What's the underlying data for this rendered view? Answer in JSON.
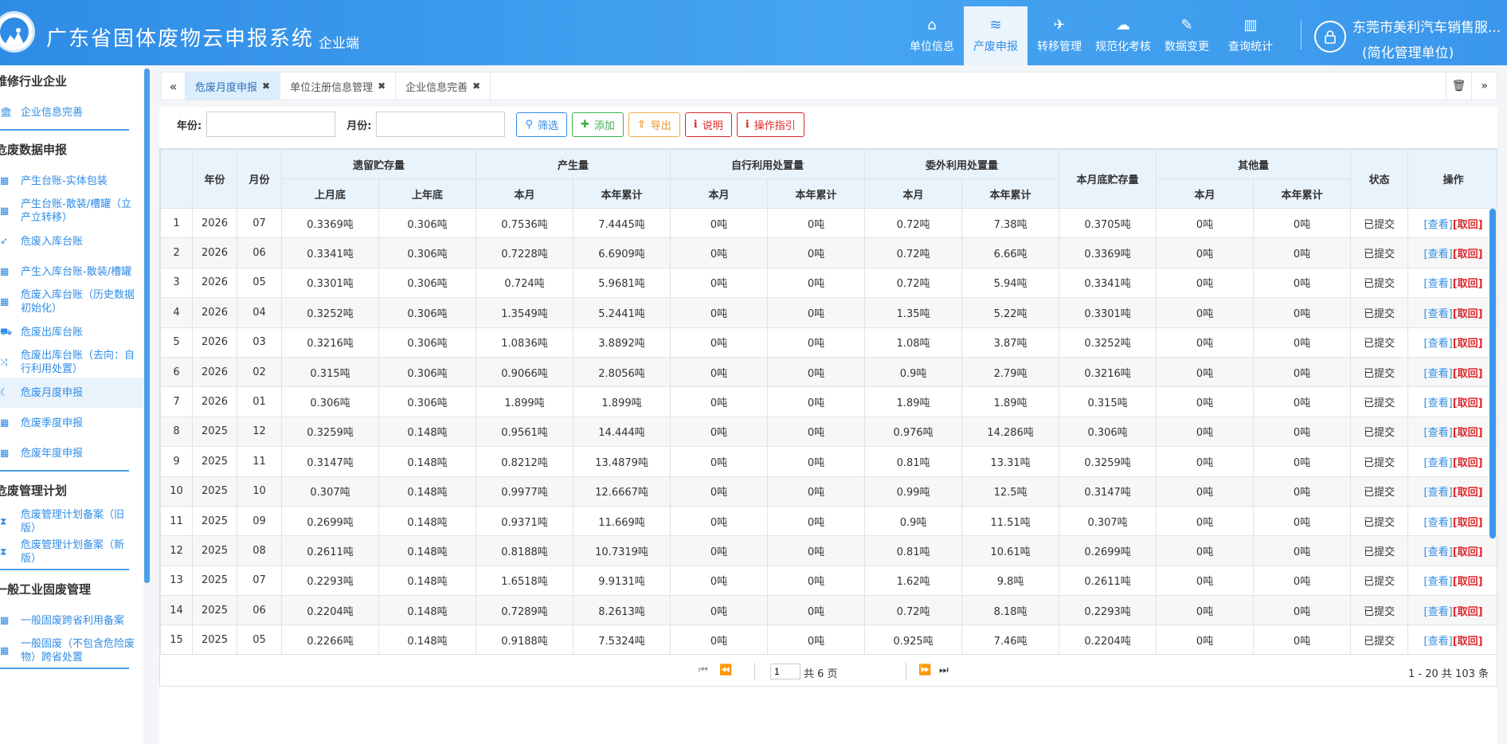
{
  "header": {
    "title": "广东省固体废物云申报系统",
    "subtitle": "企业端",
    "nav": [
      {
        "label": "单位信息",
        "icon": "home-icon",
        "glyph": "⌂",
        "active": false
      },
      {
        "label": "产废申报",
        "icon": "database-icon",
        "glyph": "≋",
        "active": true
      },
      {
        "label": "转移管理",
        "icon": "plane-icon",
        "glyph": "✈",
        "active": false
      },
      {
        "label": "规范化考核",
        "icon": "cloud-upload-icon",
        "glyph": "☁",
        "active": false
      },
      {
        "label": "数据变更",
        "icon": "edit-icon",
        "glyph": "✎",
        "active": false
      },
      {
        "label": "查询统计",
        "icon": "bar-chart-icon",
        "glyph": "▥",
        "active": false
      }
    ],
    "user_name": "东莞市美利汽车销售服...",
    "user_role": "(简化管理单位)"
  },
  "sidebar": {
    "sections": [
      {
        "title": "维修行业企业",
        "items": [
          {
            "label": "企业信息完善",
            "icon": "bank-icon",
            "glyph": "🏛"
          }
        ]
      },
      {
        "title": "危废数据申报",
        "items": [
          {
            "label": "产生台账-实体包装",
            "icon": "calendar-icon",
            "glyph": "▦"
          },
          {
            "label": "产生台账-散装/槽罐（立产立转移）",
            "icon": "calendar-icon",
            "glyph": "▦"
          },
          {
            "label": "危废入库台账",
            "icon": "rocket-icon",
            "glyph": "➶"
          },
          {
            "label": "产生入库台账-散装/槽罐",
            "icon": "calendar-icon",
            "glyph": "▦"
          },
          {
            "label": "危废入库台账（历史数据初始化）",
            "icon": "calendar-icon",
            "glyph": "▦"
          },
          {
            "label": "危废出库台账",
            "icon": "truck-icon",
            "glyph": "⛟"
          },
          {
            "label": "危废出库台账（去向：自行利用处置）",
            "icon": "shuffle-icon",
            "glyph": "⤨"
          },
          {
            "label": "危废月度申报",
            "icon": "moon-icon",
            "glyph": "☾",
            "active": true
          },
          {
            "label": "危废季度申报",
            "icon": "calendar-check-icon",
            "glyph": "▦"
          },
          {
            "label": "危废年度申报",
            "icon": "calendar-icon",
            "glyph": "▦"
          }
        ]
      },
      {
        "title": "危废管理计划",
        "items": [
          {
            "label": "危废管理计划备案（旧版）",
            "icon": "hourglass-icon",
            "glyph": "⧗"
          },
          {
            "label": "危废管理计划备案（新版）",
            "icon": "hourglass-icon",
            "glyph": "⧗"
          }
        ]
      },
      {
        "title": "一般工业固废管理",
        "items": [
          {
            "label": "一般固废跨省利用备案",
            "icon": "calendar-check-icon",
            "glyph": "▦"
          },
          {
            "label": "一般固废（不包含危险废物）跨省处置",
            "icon": "calendar-check-icon",
            "glyph": "▦"
          }
        ]
      }
    ]
  },
  "tabs": {
    "left_arrow": "«",
    "right_arrow": "»",
    "trash": "🗑",
    "items": [
      {
        "label": "危废月度申报",
        "active": true
      },
      {
        "label": "单位注册信息管理",
        "active": false
      },
      {
        "label": "企业信息完善",
        "active": false
      }
    ]
  },
  "filters": {
    "year_label": "年份:",
    "month_label": "月份:",
    "year_value": "",
    "month_value": "",
    "buttons": {
      "filter": "筛选",
      "add": "添加",
      "export": "导出",
      "explain": "说明",
      "guide": "操作指引"
    }
  },
  "table": {
    "headers_top": {
      "year": "年份",
      "month": "月份",
      "carryover": "遗留贮存量",
      "produced": "产生量",
      "self_use": "自行利用处置量",
      "outsourced": "委外利用处置量",
      "month_end_stock": "本月底贮存量",
      "other": "其他量",
      "status": "状态",
      "ops": "操作"
    },
    "headers_sub": {
      "last_month_end": "上月底",
      "last_year_end": "上年底",
      "this_month": "本月",
      "year_total": "本年累计"
    },
    "view_label": "[查看]",
    "revoke_label": "[取回]",
    "rows": [
      [
        "1",
        "2026",
        "07",
        "0.3369吨",
        "0.306吨",
        "0.7536吨",
        "7.4445吨",
        "0吨",
        "0吨",
        "0.72吨",
        "7.38吨",
        "0.3705吨",
        "0吨",
        "0吨",
        "已提交"
      ],
      [
        "2",
        "2026",
        "06",
        "0.3341吨",
        "0.306吨",
        "0.7228吨",
        "6.6909吨",
        "0吨",
        "0吨",
        "0.72吨",
        "6.66吨",
        "0.3369吨",
        "0吨",
        "0吨",
        "已提交"
      ],
      [
        "3",
        "2026",
        "05",
        "0.3301吨",
        "0.306吨",
        "0.724吨",
        "5.9681吨",
        "0吨",
        "0吨",
        "0.72吨",
        "5.94吨",
        "0.3341吨",
        "0吨",
        "0吨",
        "已提交"
      ],
      [
        "4",
        "2026",
        "04",
        "0.3252吨",
        "0.306吨",
        "1.3549吨",
        "5.2441吨",
        "0吨",
        "0吨",
        "1.35吨",
        "5.22吨",
        "0.3301吨",
        "0吨",
        "0吨",
        "已提交"
      ],
      [
        "5",
        "2026",
        "03",
        "0.3216吨",
        "0.306吨",
        "1.0836吨",
        "3.8892吨",
        "0吨",
        "0吨",
        "1.08吨",
        "3.87吨",
        "0.3252吨",
        "0吨",
        "0吨",
        "已提交"
      ],
      [
        "6",
        "2026",
        "02",
        "0.315吨",
        "0.306吨",
        "0.9066吨",
        "2.8056吨",
        "0吨",
        "0吨",
        "0.9吨",
        "2.79吨",
        "0.3216吨",
        "0吨",
        "0吨",
        "已提交"
      ],
      [
        "7",
        "2026",
        "01",
        "0.306吨",
        "0.306吨",
        "1.899吨",
        "1.899吨",
        "0吨",
        "0吨",
        "1.89吨",
        "1.89吨",
        "0.315吨",
        "0吨",
        "0吨",
        "已提交"
      ],
      [
        "8",
        "2025",
        "12",
        "0.3259吨",
        "0.148吨",
        "0.9561吨",
        "14.444吨",
        "0吨",
        "0吨",
        "0.976吨",
        "14.286吨",
        "0.306吨",
        "0吨",
        "0吨",
        "已提交"
      ],
      [
        "9",
        "2025",
        "11",
        "0.3147吨",
        "0.148吨",
        "0.8212吨",
        "13.4879吨",
        "0吨",
        "0吨",
        "0.81吨",
        "13.31吨",
        "0.3259吨",
        "0吨",
        "0吨",
        "已提交"
      ],
      [
        "10",
        "2025",
        "10",
        "0.307吨",
        "0.148吨",
        "0.9977吨",
        "12.6667吨",
        "0吨",
        "0吨",
        "0.99吨",
        "12.5吨",
        "0.3147吨",
        "0吨",
        "0吨",
        "已提交"
      ],
      [
        "11",
        "2025",
        "09",
        "0.2699吨",
        "0.148吨",
        "0.9371吨",
        "11.669吨",
        "0吨",
        "0吨",
        "0.9吨",
        "11.51吨",
        "0.307吨",
        "0吨",
        "0吨",
        "已提交"
      ],
      [
        "12",
        "2025",
        "08",
        "0.2611吨",
        "0.148吨",
        "0.8188吨",
        "10.7319吨",
        "0吨",
        "0吨",
        "0.81吨",
        "10.61吨",
        "0.2699吨",
        "0吨",
        "0吨",
        "已提交"
      ],
      [
        "13",
        "2025",
        "07",
        "0.2293吨",
        "0.148吨",
        "1.6518吨",
        "9.9131吨",
        "0吨",
        "0吨",
        "1.62吨",
        "9.8吨",
        "0.2611吨",
        "0吨",
        "0吨",
        "已提交"
      ],
      [
        "14",
        "2025",
        "06",
        "0.2204吨",
        "0.148吨",
        "0.7289吨",
        "8.2613吨",
        "0吨",
        "0吨",
        "0.72吨",
        "8.18吨",
        "0.2293吨",
        "0吨",
        "0吨",
        "已提交"
      ],
      [
        "15",
        "2025",
        "05",
        "0.2266吨",
        "0.148吨",
        "0.9188吨",
        "7.5324吨",
        "0吨",
        "0吨",
        "0.925吨",
        "7.46吨",
        "0.2204吨",
        "0吨",
        "0吨",
        "已提交"
      ]
    ]
  },
  "pager": {
    "page_value": "1",
    "total_pages": "共 6 页",
    "info": "1 - 20   共 103 条"
  }
}
